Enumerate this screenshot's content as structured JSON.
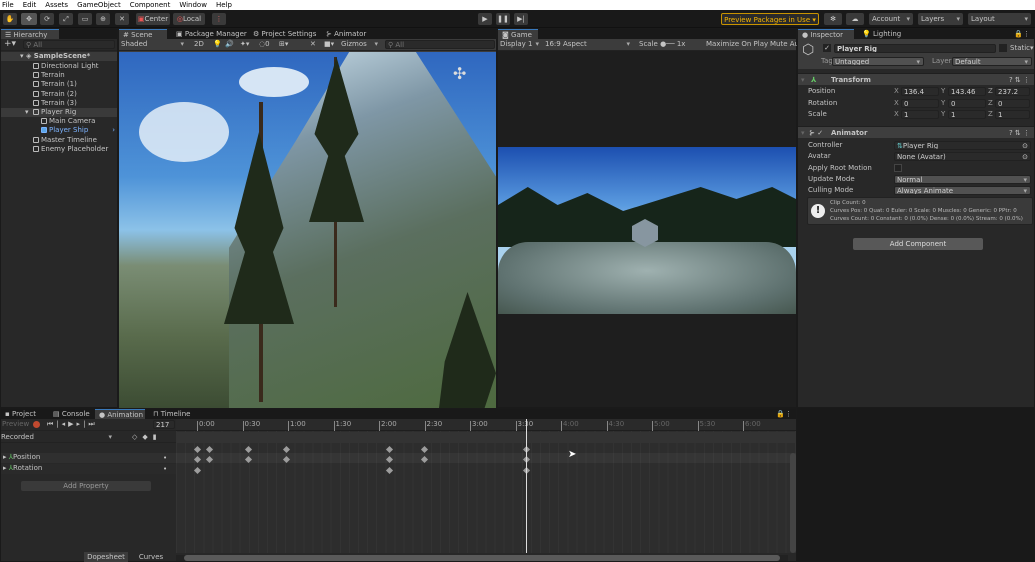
{
  "menu": [
    "File",
    "Edit",
    "Assets",
    "GameObject",
    "Component",
    "Window",
    "Help"
  ],
  "toolbar": {
    "tools": [
      "hand-tool",
      "move-tool",
      "rotate-tool",
      "scale-tool",
      "rect-tool",
      "transform-tool",
      "custom-tool"
    ],
    "pivot": "Center",
    "space": "Local",
    "preview_packages": "Preview Packages in Use",
    "account": "Account",
    "layers": "Layers",
    "layout": "Layout",
    "accent": "#f4b400"
  },
  "hierarchy": {
    "tab": "Hierarchy",
    "search_placeholder": "All",
    "scene": "SampleScene*",
    "items": [
      {
        "label": "Directional Light",
        "depth": 1
      },
      {
        "label": "Terrain",
        "depth": 1
      },
      {
        "label": "Terrain (1)",
        "depth": 1
      },
      {
        "label": "Terrain (2)",
        "depth": 1
      },
      {
        "label": "Terrain (3)",
        "depth": 1
      },
      {
        "label": "Player Rig",
        "depth": 1,
        "expanded": true,
        "selected": true
      },
      {
        "label": "Main Camera",
        "depth": 2
      },
      {
        "label": "Player Ship",
        "depth": 2,
        "prefab": true
      },
      {
        "label": "Master Timeline",
        "depth": 1
      },
      {
        "label": "Enemy Placeholder",
        "depth": 1
      }
    ]
  },
  "scene": {
    "tabs": [
      "Scene",
      "Package Manager",
      "Project Settings",
      "Animator"
    ],
    "shading": "Shaded",
    "mode_2d": "2D",
    "hidden_count": "0",
    "gizmos": "Gizmos",
    "search_placeholder": "All"
  },
  "game": {
    "tab": "Game",
    "display": "Display 1",
    "aspect": "16:9 Aspect",
    "scale_label": "Scale",
    "scale_value": "1x",
    "maximize": "Maximize On Play",
    "mute": "Mute Au"
  },
  "inspector": {
    "tabs": [
      "Inspector",
      "Lighting"
    ],
    "object_name": "Player Rig",
    "static": "Static",
    "tag_label": "Tag",
    "tag": "Untagged",
    "layer_label": "Layer",
    "layer": "Default",
    "transform": {
      "title": "Transform",
      "rows": [
        {
          "label": "Position",
          "x": "136.4",
          "y": "143.46",
          "z": "237.2"
        },
        {
          "label": "Rotation",
          "x": "0",
          "y": "0",
          "z": "0"
        },
        {
          "label": "Scale",
          "x": "1",
          "y": "1",
          "z": "1"
        }
      ]
    },
    "animator": {
      "title": "Animator",
      "rows": [
        {
          "label": "Controller",
          "value": "Player Rig"
        },
        {
          "label": "Avatar",
          "value": "None (Avatar)"
        },
        {
          "label": "Apply Root Motion",
          "value": ""
        },
        {
          "label": "Update Mode",
          "value": "Normal"
        },
        {
          "label": "Culling Mode",
          "value": "Always Animate"
        }
      ],
      "info": [
        "Clip Count: 0",
        "Curves Pos: 0 Quat: 0 Euler: 0 Scale: 0 Muscles: 0 Generic: 0 PPtr: 0",
        "Curves Count: 0 Constant: 0 (0.0%) Dense: 0 (0.0%) Stream: 0 (0.0%)"
      ]
    },
    "add_component": "Add Component"
  },
  "bottom": {
    "tabs": [
      "Project",
      "Console",
      "Animation",
      "Timeline"
    ],
    "preview": "Preview",
    "frame": "217",
    "clip": "Recorded",
    "properties": [
      "Position",
      "Rotation"
    ],
    "add_property": "Add Property",
    "dopesheet": "Dopesheet",
    "curves": "Curves",
    "ruler": [
      "0:00",
      "0:30",
      "1:00",
      "1:30",
      "2:00",
      "2:30",
      "3:00",
      "3:30",
      "4:00",
      "4:30",
      "5:00",
      "5:30",
      "6:00"
    ],
    "playhead_frame": 217,
    "keyframes": {
      "summary": [
        0,
        8,
        34,
        59,
        127,
        150,
        217
      ],
      "position": [
        0,
        8,
        34,
        59,
        127,
        150,
        217
      ],
      "rotation": [
        0,
        127,
        217
      ]
    }
  }
}
